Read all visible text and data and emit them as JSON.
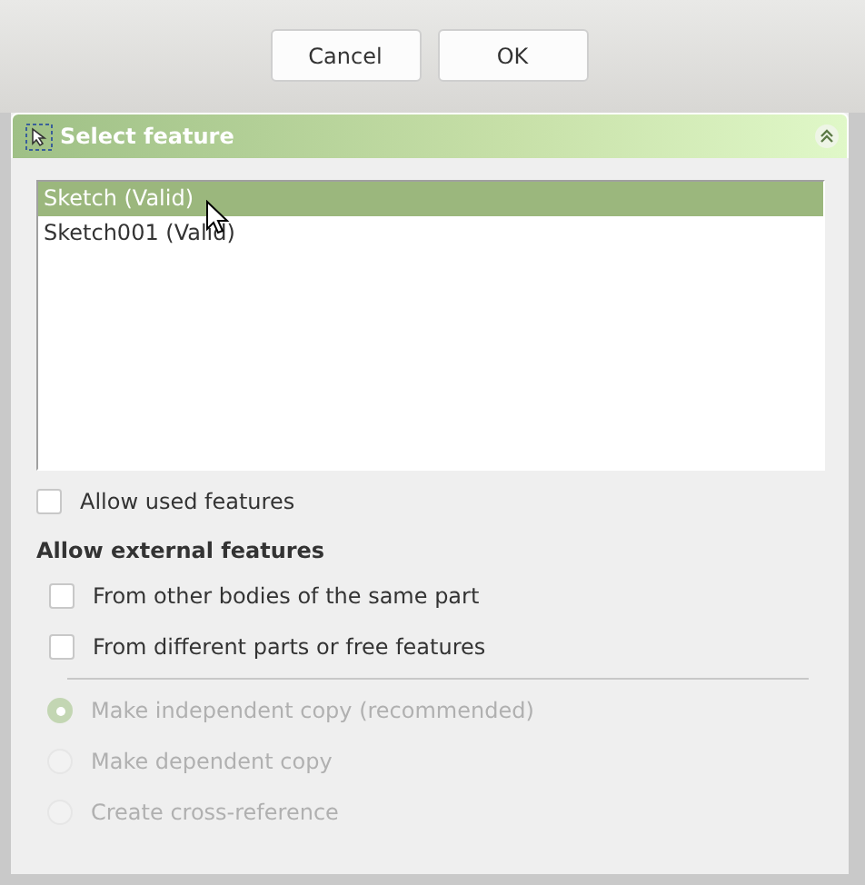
{
  "buttons": [
    {
      "label": "Cancel"
    },
    {
      "label": "OK"
    }
  ],
  "panel": {
    "title": "Select feature",
    "expanded": true,
    "features": [
      {
        "label": "Sketch (Valid)",
        "selected": true
      },
      {
        "label": "Sketch001 (Valid)",
        "selected": false
      }
    ],
    "allow_used": {
      "label": "Allow used features",
      "checked": false
    },
    "external_heading": "Allow external features",
    "external_options": [
      {
        "label": "From other bodies of the same part",
        "checked": false
      },
      {
        "label": "From different parts or free features",
        "checked": false
      }
    ],
    "copy_modes": [
      {
        "label": "Make independent copy (recommended)",
        "selected": true,
        "disabled": true
      },
      {
        "label": "Make dependent copy",
        "selected": false,
        "disabled": true
      },
      {
        "label": "Create cross-reference",
        "selected": false,
        "disabled": true
      }
    ]
  }
}
